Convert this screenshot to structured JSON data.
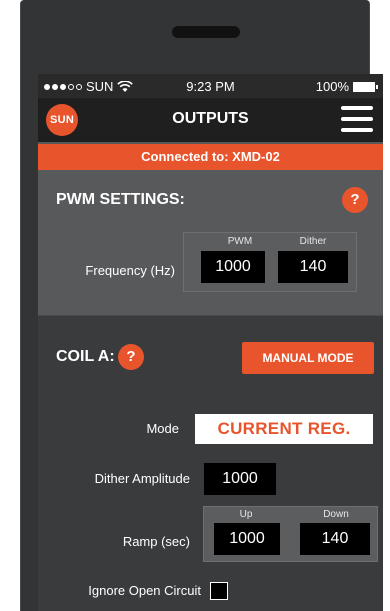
{
  "status_bar": {
    "carrier": "SUN",
    "time": "9:23 PM",
    "battery": "100%"
  },
  "nav": {
    "logo_text": "SUN",
    "title": "OUTPUTS"
  },
  "banner": {
    "text": "Connected to: XMD-02"
  },
  "pwm_settings": {
    "title": "PWM SETTINGS:",
    "help_label": "?",
    "frequency_label": "Frequency (Hz)",
    "pwm_label": "PWM",
    "pwm_value": "1000",
    "dither_label": "Dither",
    "dither_value": "140"
  },
  "coil_a": {
    "title": "COIL A:",
    "help_label": "?",
    "manual_mode_label": "MANUAL MODE",
    "mode_label": "Mode",
    "mode_value": "CURRENT REG.",
    "dither_amplitude_label": "Dither Amplitude",
    "dither_amplitude_value": "1000",
    "ramp_label": "Ramp (sec)",
    "ramp_up_label": "Up",
    "ramp_up_value": "1000",
    "ramp_down_label": "Down",
    "ramp_down_value": "140",
    "ignore_open_circuit_label": "Ignore Open Circuit",
    "ignore_open_circuit_checked": false
  },
  "colors": {
    "accent": "#e8542c",
    "phone_body": "#333436",
    "section_light": "#58595b",
    "section_dark": "#3a3b3d",
    "nav_bar": "#1f1f20"
  }
}
